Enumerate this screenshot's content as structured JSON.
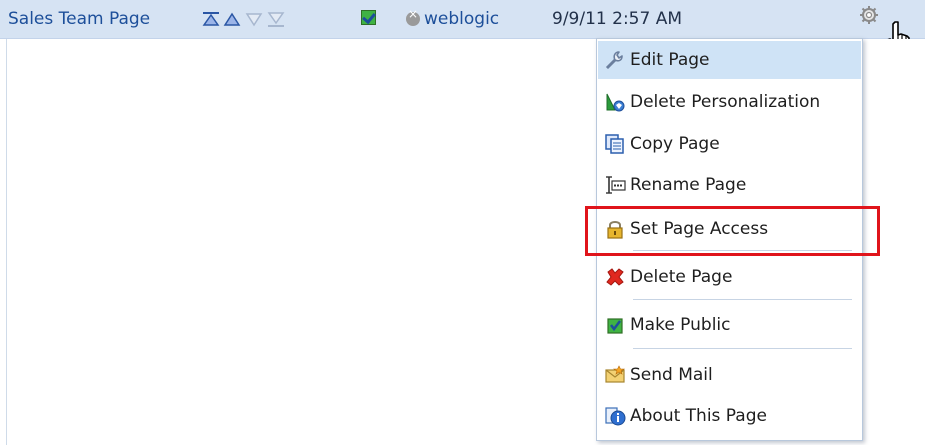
{
  "header": {
    "page_title": "Sales Team Page",
    "user": "weblogic",
    "date": "9/9/11 2:57 AM",
    "icons": [
      "move-to-top-icon",
      "move-up-icon",
      "move-down-icon",
      "move-to-bottom-icon",
      "checkbox-icon",
      "user-status-icon",
      "gear-icon",
      "hand-cursor-icon"
    ]
  },
  "menu": {
    "items": [
      {
        "label": "Edit Page",
        "icon": "wrench-icon"
      },
      {
        "label": "Delete Personalization",
        "icon": "delete-personalization-icon"
      },
      {
        "label": "Copy Page",
        "icon": "copy-page-icon"
      },
      {
        "label": "Rename Page",
        "icon": "rename-page-icon"
      },
      {
        "label": "Set Page Access",
        "icon": "lock-icon"
      },
      {
        "label": "Delete Page",
        "icon": "red-x-icon"
      },
      {
        "label": "Make Public",
        "icon": "checkbox-icon"
      },
      {
        "label": "Send Mail",
        "icon": "mail-icon"
      },
      {
        "label": "About This Page",
        "icon": "info-icon"
      }
    ]
  },
  "colors": {
    "header_bg": "#d6e3f3",
    "link": "#1d4f9a",
    "hover": "#cfe3f6",
    "highlight": "#e0141b"
  }
}
